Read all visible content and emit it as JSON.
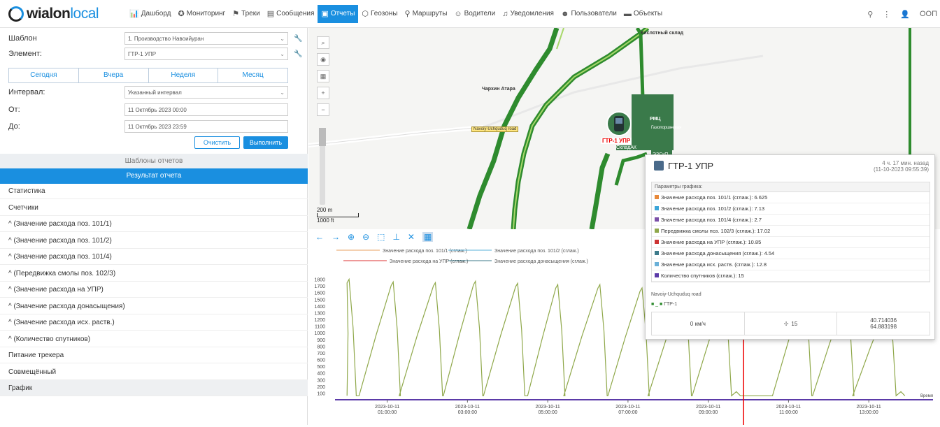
{
  "brand": {
    "logo_a": "wialon",
    "logo_b": "local"
  },
  "nav": [
    {
      "label": "Дашборд",
      "icon": "chart-icon"
    },
    {
      "label": "Мониторинг",
      "icon": "globe-icon"
    },
    {
      "label": "Треки",
      "icon": "flag-icon"
    },
    {
      "label": "Сообщения",
      "icon": "messages-icon"
    },
    {
      "label": "Отчеты",
      "icon": "report-icon",
      "active": true
    },
    {
      "label": "Геозоны",
      "icon": "geofence-icon"
    },
    {
      "label": "Маршруты",
      "icon": "routes-icon"
    },
    {
      "label": "Водители",
      "icon": "driver-icon"
    },
    {
      "label": "Уведомления",
      "icon": "bell-icon"
    },
    {
      "label": "Пользователи",
      "icon": "users-icon"
    },
    {
      "label": "Объекты",
      "icon": "car-icon"
    }
  ],
  "topright": {
    "user": "ООП"
  },
  "form": {
    "template_label": "Шаблон",
    "template_value": "1. Производство Навоийуран",
    "element_label": "Элемент:",
    "element_value": "ГТР-1 УПР",
    "quick": [
      "Сегодня",
      "Вчера",
      "Неделя",
      "Месяц"
    ],
    "interval_label": "Интервал:",
    "interval_value": "Указанный интервал",
    "from_label": "От:",
    "from_value": "11 Октябрь 2023 00:00",
    "to_label": "До:",
    "to_value": "11 Октябрь 2023 23:59",
    "clear": "Очистить",
    "execute": "Выполнить"
  },
  "sections": {
    "templates": "Шаблоны отчетов",
    "result": "Результат отчета"
  },
  "result_items": [
    "Статистика",
    "Счетчики",
    "^ (Значение расхода поз. 101/1)",
    "^ (Значение расхода поз. 101/2)",
    "^ (Значение расхода поз. 101/4)",
    "^ (Передвижка смолы поз. 102/3)",
    "^ (Значение расхода на УПР)",
    "^ (Значение расхода донасыщения)",
    "^ (Значение расхода исх. раств.)",
    "^ (Количество спутников)",
    "Питание трекера",
    "Совмещённый",
    "График"
  ],
  "map": {
    "labels": {
      "l1": "Кислотный склад",
      "l2": "Чархин Атара",
      "l3": "Navoiy-Uchquduq road",
      "l4": "РМЦ",
      "l5": "Газопоршневая",
      "l6": "СкладАК",
      "l7": "ЭЗСкП"
    },
    "unit_tag": "ГТР-1 УПР",
    "scale_m": "200 m",
    "scale_ft": "1000 ft"
  },
  "popup": {
    "title": "ГТР-1 УПР",
    "ago": "4 ч. 17 мин. назад",
    "ago_time": "(11-10-2023 09:55:39)",
    "params_header": "Параметры графика:",
    "params": [
      {
        "label": "Значение расхода поз. 101/1 (сглаж.): 6.625",
        "color": "#e8893a"
      },
      {
        "label": "Значение расхода поз. 101/2 (сглаж.): 7.13",
        "color": "#3aa5d8"
      },
      {
        "label": "Значение расхода поз. 101/4 (сглаж.): 2.7",
        "color": "#7b4fa8"
      },
      {
        "label": "Передвижка смолы поз. 102/3 (сглаж.): 17.02",
        "color": "#8fa84a"
      },
      {
        "label": "Значение расхода на УПР (сглаж.): 10.85",
        "color": "#c33"
      },
      {
        "label": "Значение расхода донасыщения (сглаж.): 4.54",
        "color": "#3d7a8a"
      },
      {
        "label": "Значение расхода исх. раств. (сглаж.): 12.8",
        "color": "#6ab0d8"
      },
      {
        "label": "Количество спутников (сглаж.): 15",
        "color": "#5b3aa8"
      }
    ],
    "road": "Navoiy-Uchquduq road",
    "object": "ГТР-1",
    "speed": "0 км/ч",
    "sats": "15",
    "lat": "40.714036",
    "lon": "64.883198"
  },
  "chart_data": {
    "type": "line",
    "legend": [
      {
        "name": "Значение расхода поз. 101/1 (сглаж.)",
        "color": "#e8a060"
      },
      {
        "name": "Значение расхода поз. 101/2 (сглаж.)",
        "color": "#5ab0d8"
      },
      {
        "name": "Значение расхода на УПР (сглаж.)",
        "color": "#d33"
      },
      {
        "name": "Значение расхода донасыщения (сглаж.)",
        "color": "#3d7a8a"
      }
    ],
    "yticks": [
      100,
      200,
      300,
      400,
      500,
      600,
      700,
      800,
      900,
      1000,
      1100,
      1200,
      1300,
      1400,
      1500,
      1600,
      1700,
      1800
    ],
    "ylim": [
      0,
      1900
    ],
    "xticks": [
      {
        "date": "2023-10-11",
        "time": "01:00:00",
        "h": 1
      },
      {
        "date": "2023-10-11",
        "time": "03:00:00",
        "h": 3
      },
      {
        "date": "2023-10-11",
        "time": "05:00:00",
        "h": 5
      },
      {
        "date": "2023-10-11",
        "time": "07:00:00",
        "h": 7
      },
      {
        "date": "2023-10-11",
        "time": "09:00:00",
        "h": 9
      },
      {
        "date": "2023-10-11",
        "time": "11:00:00",
        "h": 11
      },
      {
        "date": "2023-10-11",
        "time": "13:00:00",
        "h": 13
      }
    ],
    "x_axis_tail": "Время",
    "cursor_h": 9.88,
    "series": [
      {
        "name": "Передвижка смолы поз. 102/3 (сглаж.)",
        "color": "#8fa84a",
        "cycles_start_h": [
          0.0,
          0.3,
          1.3,
          2.4,
          3.4,
          4.5,
          5.4,
          6.5,
          7.5,
          8.6,
          10.6,
          11.6,
          12.6
        ],
        "cycles_peak_h": [
          0.05,
          1.15,
          2.2,
          3.2,
          4.25,
          5.25,
          6.3,
          7.35,
          8.4,
          9.4,
          11.4,
          12.45,
          13.5
        ],
        "peak": [
          1800,
          1760,
          1750,
          1770,
          1740,
          1720,
          1720,
          1670,
          1640,
          1540,
          1600,
          1530,
          1450
        ]
      }
    ]
  }
}
